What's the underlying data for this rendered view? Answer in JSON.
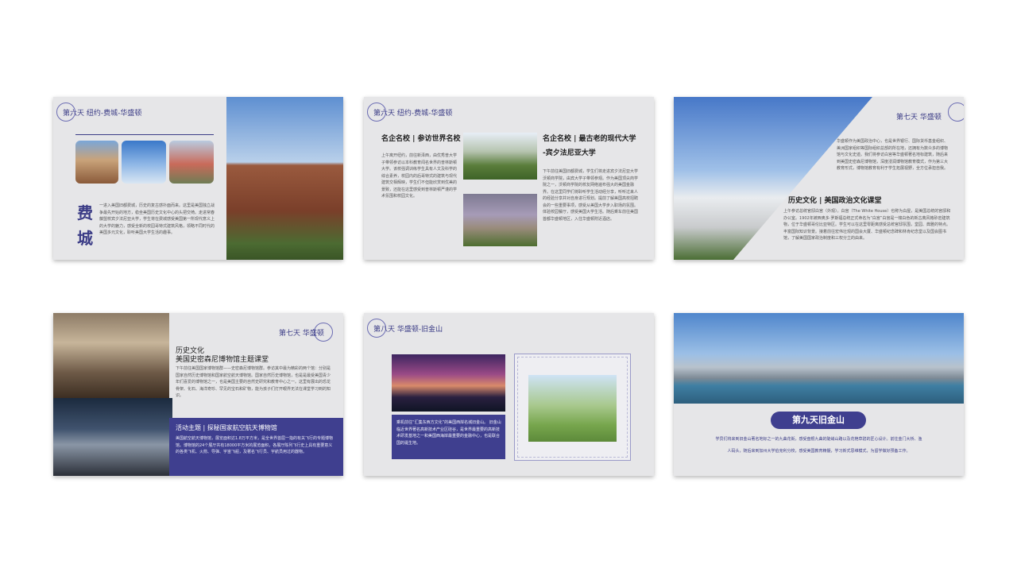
{
  "slides": {
    "s1": {
      "day": "第六天 纽约-费城-华盛顿",
      "city_char1": "费",
      "city_char2": "城",
      "body": "一进入美国旧都费城，历史的复古感扑面而来。这里是美国独立战争最先开始的地方，稳坐美国历史文化中心的头把交椅。走进常春藤盟校宾夕法尼亚大学，学生将在费城感受美国第一所现代意义上的大学的魅力，感受全新的校园哥特式建筑风格，领略不同时代的美国多元文化，聆听美国大学生活的趣事。"
    },
    "s2": {
      "day": "第六天 纽约-费城-华盛顿",
      "left_head": "名企名校 | 参访世界名校",
      "left_body": "上午离开纽约，前往新泽西，由优秀普大学子带领参访以本科教育闻名世界的普林斯顿大学。该校强调训练学生具有人文及科学的综合素养，校园内的后哥特式的建筑与现代建筑交相辉映，学生们不但能欣赏到优美的景致，还能在这里感受到普林斯顿严谨的学术氛围和校园文化。",
      "right_head": "名企名校 | 最古老的现代大学",
      "right_head2": "-宾夕法尼亚大学",
      "right_body": "下午前往美国旧都费城，学生们将走进宾夕法尼亚大学沃顿商学院，由宾大学子带领参观。作为美国顶尖商学院之一，沃顿商学院的校友网络遍布强大的美国金融界。在这里同学们将聆听学生活动经分享，听听过来人的经验分享并对自身进行规划。提前了解美国高校招聘会的一些重要事项，感受从美国大学步入职场的氛围。体验校园餐厅，感受美国大学生活。随后乘车前往美国首都华盛顿地区，入住华盛顿附近酒店。"
    },
    "s3": {
      "day": "第七天 华盛顿",
      "body_top": "华盛顿作为美国政治中心，也是世界银行、国际货币基金组织、美洲国家组织等国际组织总部的所在地，还拥有为数众多的博物馆与文化史迹。我们将参访白宫等华盛顿著名地标建筑，随后来到美国史密森尼博物馆，深度浸润博物馆教育模式，作为第三大教育形式，博物馆教育有利于学生拓展视野，全方位承担自我。",
      "head": "历史文化 | 美国政治文化课堂",
      "body": "上午参访总统官邸白宫（外观）。白宫（The White House）也称为白屋，是美国总统的官邸和办公室。1902年被西奥多·罗斯福总统正式命名为“白宫”白宫是一幢白色的新古典风格砂岩建筑物，位于华盛顿哥伦比亚特区。学生可以在这里零距离感受总统官邸氛围，堂园、典雅的特点。丰富国际知识背景。接着前往宏伟壮观的国会大厦、华盛顿纪念碑和林肯纪念堂以及国会图书馆，了解美国国家政治制度和三权分立的由来。"
    },
    "s4": {
      "day": "第七天 华盛顿",
      "head1": "历史文化",
      "head2": "美国史密森尼博物馆主题课堂",
      "body": "下午前往美国国家博物馆群——史密森尼博物馆群。参访其中最为精彩的两个馆：分别是国家自然历史博物馆和国家航空航天博物馆。国家自然历史博物馆，也是是最受美国青少年们喜爱的博物馆之一，也是美国主要的自然史研究和教育中心之一。这里有展出的恐龙骨架、化石、海洋奇珍、罕见的宝石和矿物，能为孩子们打开眼界无法在课堂学习到的知识。",
      "box_head": "活动主题 | 探秘国家航空航天博物馆",
      "box_body": "美国航空航天博物馆，展览面积达1.8万平方米，是全世界首屈一指的有关飞行的专题博物馆。博物馆的24个展厅共有18000平方米的展览面积，各展厅陈列飞行史上具有重要意义的各类飞机、火箭、导弹、宇宙飞船，及著名飞行员、宇航员用过的器物。"
    },
    "s5": {
      "day": "第八天 华盛顿-旧金山",
      "box_body": "乘机前往“汇集东西方文化”的美国西岸名城旧金山。 旧金山临近世界著名高新技术产业区硅谷，是世界最重要的高新技术研发基地之一和美国西海岸最重要的金融中心，也是联合国的诞生地。"
    },
    "s6": {
      "title": "第九天旧金山",
      "body1": "学员们将来到旧金山著名地标之一的九曲花街，感受盘根九曲的陡峭山路以及花艳草碧的匠心设计。前往金门大桥、渔",
      "body2": "人码头，随后来到加州大学伯克利分校，感受美国教育精髓，学习新式思维模式，为留学做好预备工作。"
    }
  },
  "colors": {
    "accent": "#3f3f8f",
    "slide_bg": "#e6e6e8"
  }
}
